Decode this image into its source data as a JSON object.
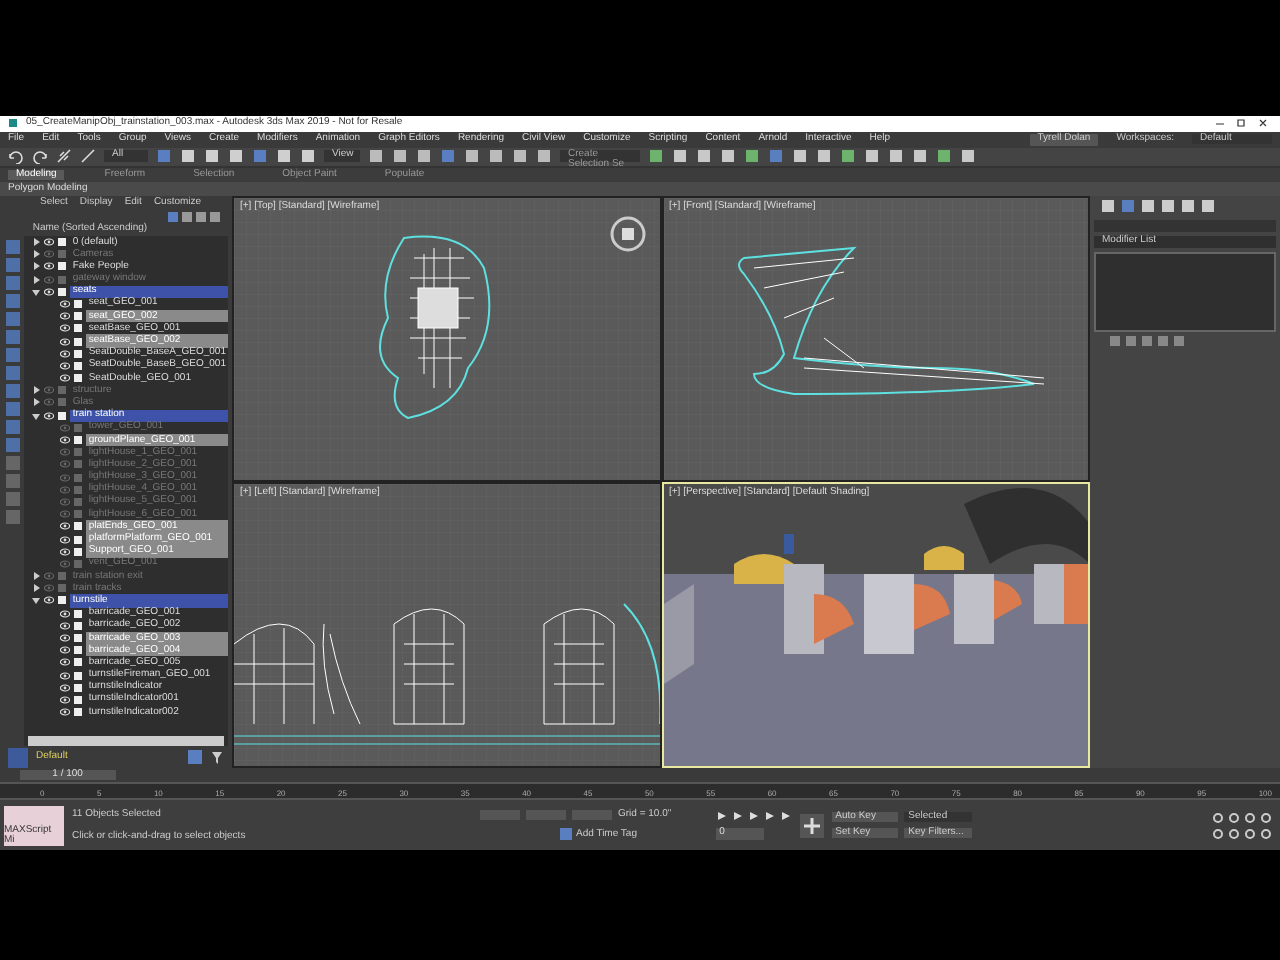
{
  "window": {
    "title": "05_CreateManipObj_trainstation_003.max - Autodesk 3ds Max 2019 - Not for Resale"
  },
  "menu": [
    "File",
    "Edit",
    "Tools",
    "Group",
    "Views",
    "Create",
    "Modifiers",
    "Animation",
    "Graph Editors",
    "Rendering",
    "Civil View",
    "Customize",
    "Scripting",
    "Content",
    "Arnold",
    "Interactive",
    "Help"
  ],
  "user": {
    "name": "Tyrell Dolan",
    "workspaces_label": "Workspaces:",
    "workspace": "Default"
  },
  "toolbar": {
    "selection_filter": "All",
    "named_selection": "Create Selection Se",
    "view": "View"
  },
  "ribbon_tabs": [
    {
      "label": "Modeling",
      "selected": true
    },
    {
      "label": "Freeform",
      "selected": false
    },
    {
      "label": "Selection",
      "selected": false
    },
    {
      "label": "Object Paint",
      "selected": false
    },
    {
      "label": "Populate",
      "selected": false
    }
  ],
  "ribbon_panel": "Polygon Modeling",
  "scene_explorer": {
    "menu": [
      "Select",
      "Display",
      "Edit",
      "Customize"
    ],
    "header": "Name (Sorted Ascending)",
    "layer": "Default",
    "items": [
      {
        "name": "0 (default)",
        "selected": false,
        "hidden": false
      },
      {
        "name": "Cameras",
        "selected": false,
        "hidden": true
      },
      {
        "name": "Fake People",
        "selected": false,
        "hidden": false
      },
      {
        "name": "gateway window",
        "selected": false,
        "hidden": true
      },
      {
        "name": "seats",
        "selected": true,
        "hidden": false,
        "children": [
          {
            "name": "seat_GEO_001",
            "selected": false,
            "hidden": false
          },
          {
            "name": "seat_GEO_002",
            "selected": true,
            "hidden": false
          },
          {
            "name": "seatBase_GEO_001",
            "selected": false,
            "hidden": false
          },
          {
            "name": "seatBase_GEO_002",
            "selected": true,
            "hidden": false
          },
          {
            "name": "SeatDouble_BaseA_GEO_001",
            "selected": false,
            "hidden": false
          },
          {
            "name": "SeatDouble_BaseB_GEO_001",
            "selected": false,
            "hidden": false
          },
          {
            "name": "SeatDouble_GEO_001",
            "selected": false,
            "hidden": false
          }
        ]
      },
      {
        "name": "structure",
        "selected": false,
        "hidden": true
      },
      {
        "name": "Glas",
        "selected": false,
        "hidden": true
      },
      {
        "name": "train station",
        "selected": true,
        "hidden": false,
        "children": [
          {
            "name": "tower_GEO_001",
            "selected": false,
            "hidden": true
          },
          {
            "name": "groundPlane_GEO_001",
            "selected": true,
            "hidden": false
          },
          {
            "name": "lightHouse_1_GEO_001",
            "selected": false,
            "hidden": true
          },
          {
            "name": "lightHouse_2_GEO_001",
            "selected": false,
            "hidden": true
          },
          {
            "name": "lightHouse_3_GEO_001",
            "selected": false,
            "hidden": true
          },
          {
            "name": "lightHouse_4_GEO_001",
            "selected": false,
            "hidden": true
          },
          {
            "name": "lightHouse_5_GEO_001",
            "selected": false,
            "hidden": true
          },
          {
            "name": "lightHouse_6_GEO_001",
            "selected": false,
            "hidden": true
          },
          {
            "name": "platEnds_GEO_001",
            "selected": true,
            "hidden": false
          },
          {
            "name": "platformPlatform_GEO_001",
            "selected": true,
            "hidden": false
          },
          {
            "name": "Support_GEO_001",
            "selected": true,
            "hidden": false
          },
          {
            "name": "vent_GEO_001",
            "selected": false,
            "hidden": true
          }
        ]
      },
      {
        "name": "train station exit",
        "selected": false,
        "hidden": true
      },
      {
        "name": "train tracks",
        "selected": false,
        "hidden": true
      },
      {
        "name": "turnstile",
        "selected": true,
        "hidden": false,
        "children": [
          {
            "name": "barricade_GEO_001",
            "selected": false,
            "hidden": false
          },
          {
            "name": "barricade_GEO_002",
            "selected": false,
            "hidden": false
          },
          {
            "name": "barricade_GEO_003",
            "selected": true,
            "hidden": false
          },
          {
            "name": "barricade_GEO_004",
            "selected": true,
            "hidden": false
          },
          {
            "name": "barricade_GEO_005",
            "selected": false,
            "hidden": false
          },
          {
            "name": "turnstileFireman_GEO_001",
            "selected": false,
            "hidden": false
          },
          {
            "name": "turnstileIndicator",
            "selected": false,
            "hidden": false
          },
          {
            "name": "turnstileIndicator001",
            "selected": false,
            "hidden": false
          },
          {
            "name": "turnstileIndicator002",
            "selected": false,
            "hidden": false
          }
        ]
      }
    ]
  },
  "viewports": [
    {
      "label": "[+] [Top] [Standard] [Wireframe]",
      "kind": "top",
      "active": false
    },
    {
      "label": "[+] [Front] [Standard] [Wireframe]",
      "kind": "front",
      "active": false
    },
    {
      "label": "[+] [Left] [Standard] [Wireframe]",
      "kind": "left",
      "active": false
    },
    {
      "label": "[+] [Perspective] [Standard] [Default Shading]",
      "kind": "perspective",
      "active": true
    }
  ],
  "command_panel": {
    "modifier_list": "Modifier List"
  },
  "time_slider": {
    "label": "1 / 100",
    "level": 0.01
  },
  "timeline_ticks": [
    "0",
    "5",
    "10",
    "15",
    "20",
    "25",
    "30",
    "35",
    "40",
    "45",
    "50",
    "55",
    "60",
    "65",
    "70",
    "75",
    "80",
    "85",
    "90",
    "95",
    "100"
  ],
  "status_bar": {
    "maxscript": "MAXScript Mi",
    "selection": "11 Objects Selected",
    "prompt": "Click or click-and-drag to select objects",
    "grid": "Grid = 10.0\"",
    "add_time_tag": "Add Time Tag",
    "auto_key": "Auto Key",
    "key_mode": "Selected",
    "set_key": "Set Key",
    "key_filters": "Key Filters...",
    "frame": "0"
  }
}
